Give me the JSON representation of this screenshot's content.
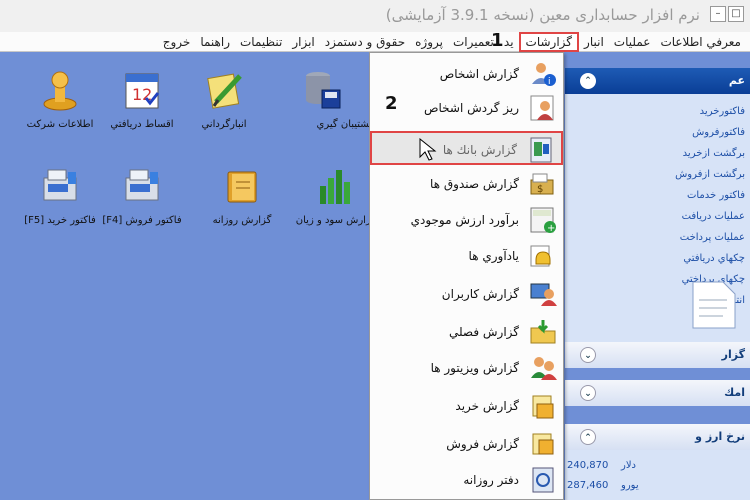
{
  "window": {
    "title": "نرم افزار حسابداری معین (نسخه 3.9.1 آزمایشی)"
  },
  "menubar": {
    "items": [
      "معرفي اطلاعات",
      "عمليات",
      "انبار",
      "گزارشات",
      "يد",
      "تعميرات",
      "پروژه",
      "حقوق و دستمزد",
      "ابزار",
      "تنظيمات",
      "راهنما",
      "خروج"
    ]
  },
  "desktop": {
    "icons": [
      {
        "label": "اطلاعات شركت",
        "icon": "stamp-icon"
      },
      {
        "label": "اقساط دريافتي",
        "icon": "calendar-icon"
      },
      {
        "label": "انبارگرداني",
        "icon": "notepad-pencil-icon"
      },
      {
        "label": "پشتيبان گيري",
        "icon": "database-backup-icon"
      },
      {
        "label": "فاكتور خريد [F5]",
        "icon": "cash-register-icon"
      },
      {
        "label": "فاكتور فروش [F4]",
        "icon": "cash-register-icon"
      },
      {
        "label": "گزارش روزانه",
        "icon": "book-icon"
      },
      {
        "label": "گزارش سود و زيان",
        "icon": "bar-chart-icon"
      }
    ]
  },
  "dropdown": {
    "items": [
      {
        "label": "گزارش اشخاص",
        "icon": "person-info-icon"
      },
      {
        "label": "ريز گردش اشخاص",
        "icon": "person-document-icon"
      },
      {
        "label": "گزارش بانك ها",
        "icon": "bank-icon"
      },
      {
        "label": "گزارش صندوق ها",
        "icon": "cash-box-icon"
      },
      {
        "label": "برآورد ارزش موجودي",
        "icon": "calculator-icon"
      },
      {
        "label": "يادآوري ها",
        "icon": "reminder-bell-icon"
      },
      {
        "label": "گزارش كاربران",
        "icon": "users-monitor-icon"
      },
      {
        "label": "گزارش فصلي",
        "icon": "folder-arrow-icon"
      },
      {
        "label": "گزارش ويزيتور ها",
        "icon": "visitors-icon"
      },
      {
        "label": "گزارش خريد",
        "icon": "purchase-report-icon"
      },
      {
        "label": "گزارش فروش",
        "icon": "sales-report-icon"
      },
      {
        "label": "دفتر روزانه",
        "icon": "daybook-icon"
      }
    ]
  },
  "panel": {
    "header1": "عم",
    "links": [
      "فاكتورخريد",
      "فاكتورفروش",
      "برگشت ازخريد",
      "برگشت ازفروش",
      "فاكتور خدمات",
      "عمليات دريافت",
      "عمليات پرداخت",
      "چكهاي دريافتي",
      "چكهاي پرداختي",
      "انتقال وجه"
    ],
    "header2": "گزار",
    "header3": "امك",
    "header4": "نرخ ارز و",
    "currencies": [
      {
        "name": "دلار",
        "value": "240,870"
      },
      {
        "name": "يورو",
        "value": "287,460"
      }
    ]
  },
  "annotations": {
    "step1": "1",
    "step2": "2"
  },
  "colors": {
    "desktop": "#6f8fd6",
    "highlight_border": "#e04545",
    "panel_header": "#0a3e96"
  }
}
